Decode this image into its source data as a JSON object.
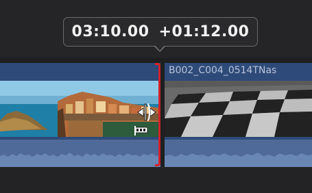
{
  "tooltip": {
    "timecode": "03:10.00",
    "offset": "+01:12.00"
  },
  "clips": {
    "left": {
      "thumbnail": "coastal-village-thumbnail"
    },
    "right": {
      "name": "B002_C004_0514TNas",
      "thumbnail": "checkerboard-floor-thumbnail"
    }
  },
  "edit_point": {
    "color": "#d1222a"
  },
  "colors": {
    "clip_fill": "#2e4a78",
    "waveform_fill": "#4f6a98",
    "tooltip_bg": "#2a2a2c"
  },
  "icons": [
    "ripple-trim-cursor-icon"
  ]
}
